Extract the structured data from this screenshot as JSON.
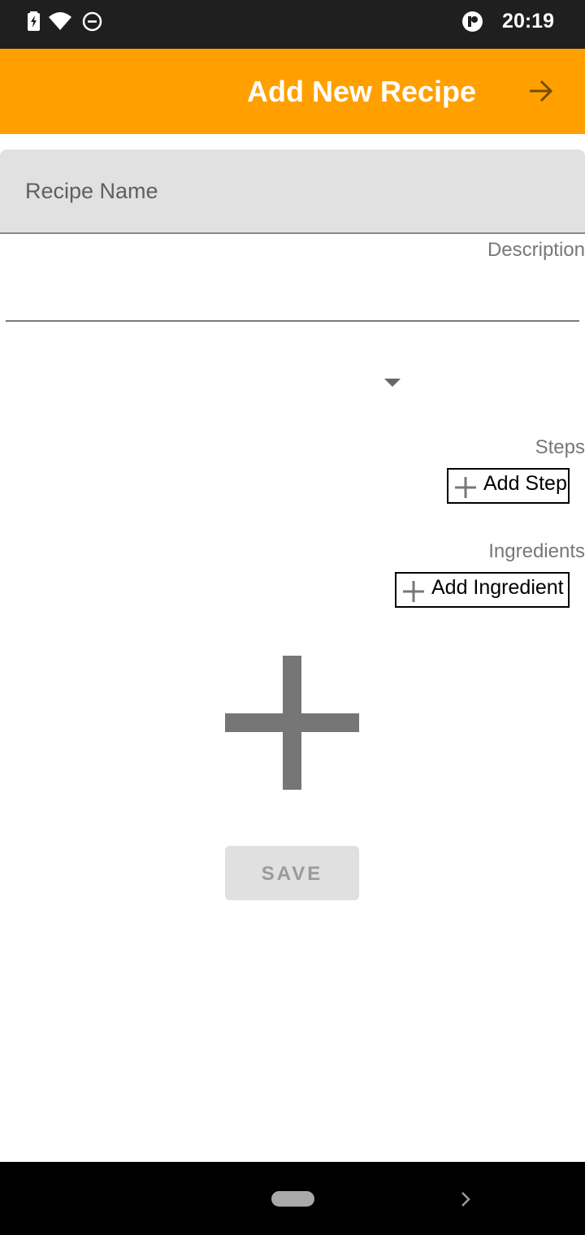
{
  "status_bar": {
    "time": "20:19",
    "icons": [
      "battery-charging-icon",
      "wifi-icon",
      "do-not-disturb-icon",
      "app-notification-icon"
    ]
  },
  "app_bar": {
    "title": "Add New Recipe",
    "action_icon": "arrow-forward-icon",
    "background": "#ffa000"
  },
  "form": {
    "recipe_name_placeholder": "Recipe Name",
    "recipe_name_value": "",
    "description_label": "Description",
    "description_value": "",
    "category_selected": "",
    "steps_label": "Steps",
    "add_step_label": "Add Step",
    "ingredients_label": "Ingredients",
    "add_ingredient_label": "Add Ingredient",
    "add_image_icon": "add-icon",
    "save_label": "SAVE"
  },
  "nav_bar": {
    "icons": [
      "home-pill-icon",
      "chevron-right-icon"
    ]
  }
}
